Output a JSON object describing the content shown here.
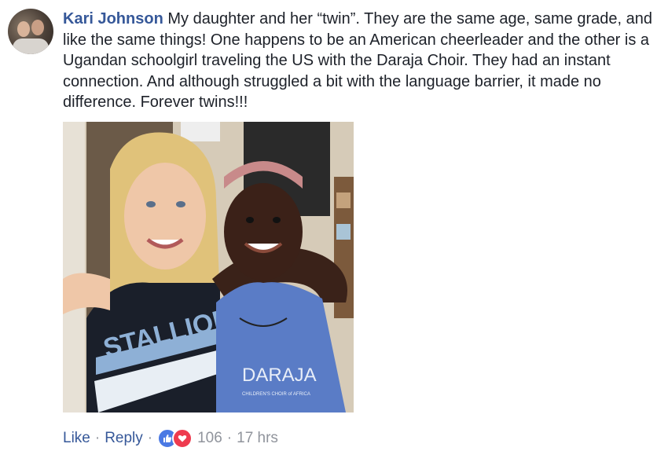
{
  "comment": {
    "author": "Kari Johnson",
    "text": "My daughter and her “twin”. They are the same age, same grade, and like the same things! One happens to be an American cheerleader and the other is a Ugandan schoolgirl traveling the US with the Daraja Choir. They had an instant connection. And although struggled a bit with the language barrier, it made no difference. Forever twins!!!",
    "photo": {
      "uniform_text": "STALLIONS",
      "shirt_text": "DARAJA",
      "shirt_subtext": "CHILDREN'S CHOIR of AFRICA"
    }
  },
  "actions": {
    "like_label": "Like",
    "reply_label": "Reply",
    "separator": "·",
    "reaction_count": "106",
    "timestamp": "17 hrs"
  },
  "icons": {
    "like": "thumbs-up-icon",
    "love": "heart-icon"
  },
  "colors": {
    "link": "#365899",
    "text": "#1d2129",
    "meta": "#90949c",
    "like_blue": "#4a79e4",
    "love_red": "#ee3b4f"
  }
}
